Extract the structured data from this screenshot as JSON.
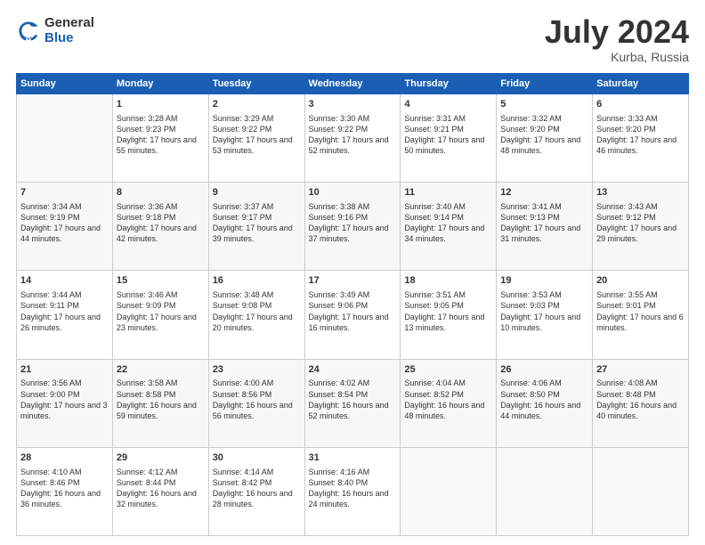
{
  "logo": {
    "general": "General",
    "blue": "Blue"
  },
  "title": {
    "month": "July 2024",
    "location": "Kurba, Russia"
  },
  "days_header": [
    "Sunday",
    "Monday",
    "Tuesday",
    "Wednesday",
    "Thursday",
    "Friday",
    "Saturday"
  ],
  "weeks": [
    [
      {
        "day": "",
        "sunrise": "",
        "sunset": "",
        "daylight": ""
      },
      {
        "day": "1",
        "sunrise": "Sunrise: 3:28 AM",
        "sunset": "Sunset: 9:23 PM",
        "daylight": "Daylight: 17 hours and 55 minutes."
      },
      {
        "day": "2",
        "sunrise": "Sunrise: 3:29 AM",
        "sunset": "Sunset: 9:22 PM",
        "daylight": "Daylight: 17 hours and 53 minutes."
      },
      {
        "day": "3",
        "sunrise": "Sunrise: 3:30 AM",
        "sunset": "Sunset: 9:22 PM",
        "daylight": "Daylight: 17 hours and 52 minutes."
      },
      {
        "day": "4",
        "sunrise": "Sunrise: 3:31 AM",
        "sunset": "Sunset: 9:21 PM",
        "daylight": "Daylight: 17 hours and 50 minutes."
      },
      {
        "day": "5",
        "sunrise": "Sunrise: 3:32 AM",
        "sunset": "Sunset: 9:20 PM",
        "daylight": "Daylight: 17 hours and 48 minutes."
      },
      {
        "day": "6",
        "sunrise": "Sunrise: 3:33 AM",
        "sunset": "Sunset: 9:20 PM",
        "daylight": "Daylight: 17 hours and 46 minutes."
      }
    ],
    [
      {
        "day": "7",
        "sunrise": "Sunrise: 3:34 AM",
        "sunset": "Sunset: 9:19 PM",
        "daylight": "Daylight: 17 hours and 44 minutes."
      },
      {
        "day": "8",
        "sunrise": "Sunrise: 3:36 AM",
        "sunset": "Sunset: 9:18 PM",
        "daylight": "Daylight: 17 hours and 42 minutes."
      },
      {
        "day": "9",
        "sunrise": "Sunrise: 3:37 AM",
        "sunset": "Sunset: 9:17 PM",
        "daylight": "Daylight: 17 hours and 39 minutes."
      },
      {
        "day": "10",
        "sunrise": "Sunrise: 3:38 AM",
        "sunset": "Sunset: 9:16 PM",
        "daylight": "Daylight: 17 hours and 37 minutes."
      },
      {
        "day": "11",
        "sunrise": "Sunrise: 3:40 AM",
        "sunset": "Sunset: 9:14 PM",
        "daylight": "Daylight: 17 hours and 34 minutes."
      },
      {
        "day": "12",
        "sunrise": "Sunrise: 3:41 AM",
        "sunset": "Sunset: 9:13 PM",
        "daylight": "Daylight: 17 hours and 31 minutes."
      },
      {
        "day": "13",
        "sunrise": "Sunrise: 3:43 AM",
        "sunset": "Sunset: 9:12 PM",
        "daylight": "Daylight: 17 hours and 29 minutes."
      }
    ],
    [
      {
        "day": "14",
        "sunrise": "Sunrise: 3:44 AM",
        "sunset": "Sunset: 9:11 PM",
        "daylight": "Daylight: 17 hours and 26 minutes."
      },
      {
        "day": "15",
        "sunrise": "Sunrise: 3:46 AM",
        "sunset": "Sunset: 9:09 PM",
        "daylight": "Daylight: 17 hours and 23 minutes."
      },
      {
        "day": "16",
        "sunrise": "Sunrise: 3:48 AM",
        "sunset": "Sunset: 9:08 PM",
        "daylight": "Daylight: 17 hours and 20 minutes."
      },
      {
        "day": "17",
        "sunrise": "Sunrise: 3:49 AM",
        "sunset": "Sunset: 9:06 PM",
        "daylight": "Daylight: 17 hours and 16 minutes."
      },
      {
        "day": "18",
        "sunrise": "Sunrise: 3:51 AM",
        "sunset": "Sunset: 9:05 PM",
        "daylight": "Daylight: 17 hours and 13 minutes."
      },
      {
        "day": "19",
        "sunrise": "Sunrise: 3:53 AM",
        "sunset": "Sunset: 9:03 PM",
        "daylight": "Daylight: 17 hours and 10 minutes."
      },
      {
        "day": "20",
        "sunrise": "Sunrise: 3:55 AM",
        "sunset": "Sunset: 9:01 PM",
        "daylight": "Daylight: 17 hours and 6 minutes."
      }
    ],
    [
      {
        "day": "21",
        "sunrise": "Sunrise: 3:56 AM",
        "sunset": "Sunset: 9:00 PM",
        "daylight": "Daylight: 17 hours and 3 minutes."
      },
      {
        "day": "22",
        "sunrise": "Sunrise: 3:58 AM",
        "sunset": "Sunset: 8:58 PM",
        "daylight": "Daylight: 16 hours and 59 minutes."
      },
      {
        "day": "23",
        "sunrise": "Sunrise: 4:00 AM",
        "sunset": "Sunset: 8:56 PM",
        "daylight": "Daylight: 16 hours and 56 minutes."
      },
      {
        "day": "24",
        "sunrise": "Sunrise: 4:02 AM",
        "sunset": "Sunset: 8:54 PM",
        "daylight": "Daylight: 16 hours and 52 minutes."
      },
      {
        "day": "25",
        "sunrise": "Sunrise: 4:04 AM",
        "sunset": "Sunset: 8:52 PM",
        "daylight": "Daylight: 16 hours and 48 minutes."
      },
      {
        "day": "26",
        "sunrise": "Sunrise: 4:06 AM",
        "sunset": "Sunset: 8:50 PM",
        "daylight": "Daylight: 16 hours and 44 minutes."
      },
      {
        "day": "27",
        "sunrise": "Sunrise: 4:08 AM",
        "sunset": "Sunset: 8:48 PM",
        "daylight": "Daylight: 16 hours and 40 minutes."
      }
    ],
    [
      {
        "day": "28",
        "sunrise": "Sunrise: 4:10 AM",
        "sunset": "Sunset: 8:46 PM",
        "daylight": "Daylight: 16 hours and 36 minutes."
      },
      {
        "day": "29",
        "sunrise": "Sunrise: 4:12 AM",
        "sunset": "Sunset: 8:44 PM",
        "daylight": "Daylight: 16 hours and 32 minutes."
      },
      {
        "day": "30",
        "sunrise": "Sunrise: 4:14 AM",
        "sunset": "Sunset: 8:42 PM",
        "daylight": "Daylight: 16 hours and 28 minutes."
      },
      {
        "day": "31",
        "sunrise": "Sunrise: 4:16 AM",
        "sunset": "Sunset: 8:40 PM",
        "daylight": "Daylight: 16 hours and 24 minutes."
      },
      {
        "day": "",
        "sunrise": "",
        "sunset": "",
        "daylight": ""
      },
      {
        "day": "",
        "sunrise": "",
        "sunset": "",
        "daylight": ""
      },
      {
        "day": "",
        "sunrise": "",
        "sunset": "",
        "daylight": ""
      }
    ]
  ]
}
